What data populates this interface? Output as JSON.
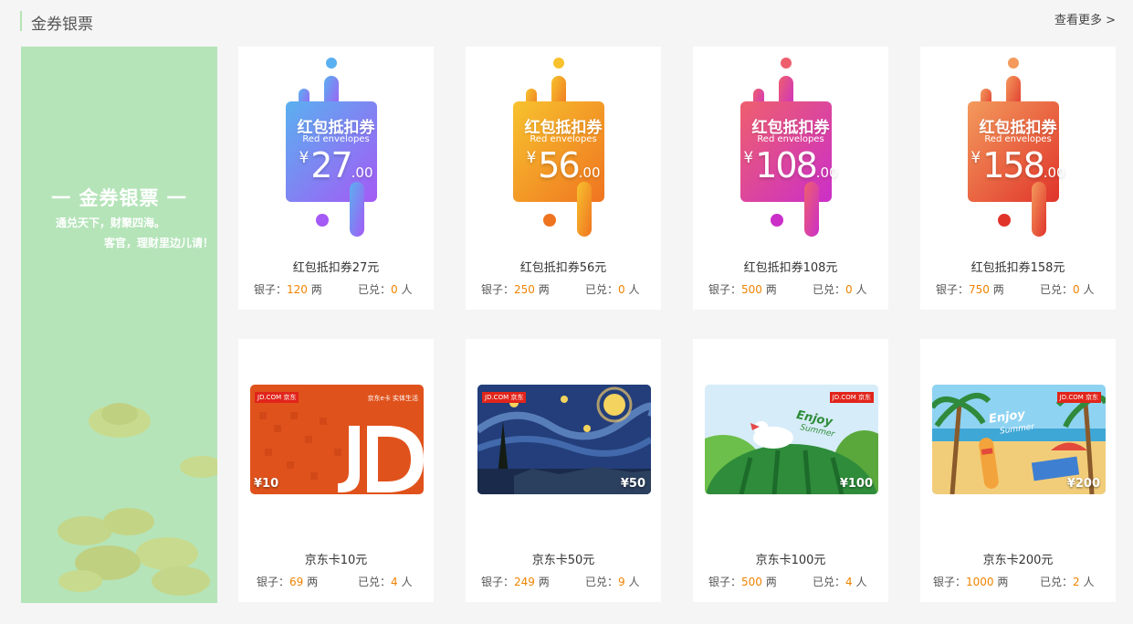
{
  "header": {
    "title": "金券银票",
    "more": "查看更多 >"
  },
  "banner": {
    "title": "一 金券银票 一",
    "subtitle1": "通兑天下，财聚四海。",
    "subtitle2": "客官，理财里边儿请！"
  },
  "labels": {
    "silver": "银子：",
    "silver_unit": "两",
    "redeemed": "已兑：",
    "redeemed_unit": "人"
  },
  "coupon_text": {
    "cn": "红包抵扣券",
    "en": "Red envelopes",
    "yen": "¥",
    "dec": ".00"
  },
  "row1": [
    {
      "name": "红包抵扣券27元",
      "amount": "27",
      "silver": "120",
      "redeemed": "0",
      "color1": "#5ab0f0",
      "color2": "#a45af5"
    },
    {
      "name": "红包抵扣券56元",
      "amount": "56",
      "silver": "250",
      "redeemed": "0",
      "color1": "#f7c22e",
      "color2": "#ef7420"
    },
    {
      "name": "红包抵扣券108元",
      "amount": "108",
      "silver": "500",
      "redeemed": "0",
      "color1": "#ee5f6e",
      "color2": "#cb2fc8"
    },
    {
      "name": "红包抵扣券158元",
      "amount": "158",
      "silver": "750",
      "redeemed": "0",
      "color1": "#f39a5c",
      "color2": "#e0342b"
    }
  ],
  "row2": [
    {
      "name": "京东卡10元",
      "value": "¥10",
      "silver": "69",
      "redeemed": "4"
    },
    {
      "name": "京东卡50元",
      "value": "¥50",
      "silver": "249",
      "redeemed": "9"
    },
    {
      "name": "京东卡100元",
      "value": "¥100",
      "silver": "500",
      "redeemed": "4"
    },
    {
      "name": "京东卡200元",
      "value": "¥200",
      "silver": "1000",
      "redeemed": "2"
    }
  ],
  "card_art": {
    "jd_logo": "JD.COM 京东",
    "card1_partner": "京东e卡 实体生活",
    "card1_big": "JD",
    "enjoy": "Enjoy",
    "summer": "Summer"
  }
}
